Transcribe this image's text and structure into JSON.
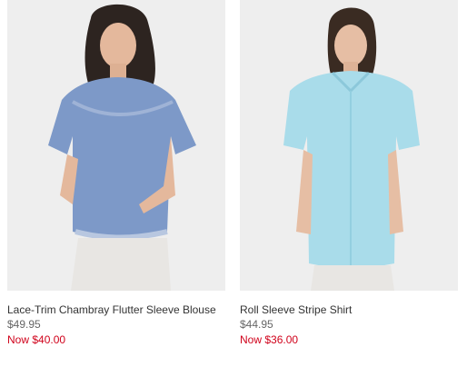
{
  "colors": {
    "sale": "#d0021b",
    "image_bg": "#eeeeee"
  },
  "products": [
    {
      "name": "Lace-Trim Chambray Flutter Sleeve Blouse",
      "price": "$49.95",
      "sale_price": "Now $40.00",
      "shirt_color": "#7d99c8"
    },
    {
      "name": "Roll Sleeve Stripe Shirt",
      "price": "$44.95",
      "sale_price": "Now $36.00",
      "shirt_color": "#a9dcea"
    }
  ]
}
